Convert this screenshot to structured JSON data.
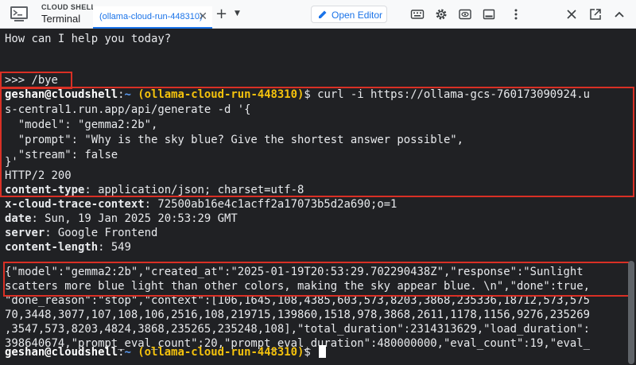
{
  "header": {
    "brand": "CLOUD SHELL",
    "title": "Terminal",
    "tab_label": "(ollama-cloud-run-448310)",
    "tab_close": "✕",
    "add_tab": "+",
    "tab_menu": "▼",
    "open_editor": "Open Editor"
  },
  "colors": {
    "accent": "#1a73e8",
    "highlight_box": "#d93025",
    "project_text": "#f4c20d",
    "path_text": "#5b9cf5",
    "terminal_bg": "#202124"
  },
  "terminal": {
    "greeting": "How can I help you today?",
    "bye": ">>> /bye",
    "prompt": {
      "user": "geshan@cloudshell",
      "sep": ":",
      "path": "~",
      "project": "(ollama-cloud-run-448310)",
      "dollar": "$ "
    },
    "curl_lines": [
      "curl -i https://ollama-gcs-760173090924.u",
      "s-central1.run.app/api/generate -d '{",
      "  \"model\": \"gemma2:2b\",",
      "  \"prompt\": \"Why is the sky blue? Give the shortest answer possible\",",
      "  \"stream\": false",
      "}'"
    ],
    "status_line": "HTTP/2 200",
    "headers": [
      {
        "key": "content-type",
        "value": ": application/json; charset=utf-8"
      },
      {
        "key": "x-cloud-trace-context",
        "value": ": 72500ab16e4c1acff2a17073b5d2a690;o=1"
      },
      {
        "key": "date",
        "value": ": Sun, 19 Jan 2025 20:53:29 GMT"
      },
      {
        "key": "server",
        "value": ": Google Frontend"
      },
      {
        "key": "content-length",
        "value": ": 549"
      }
    ],
    "body_lines": [
      "{\"model\":\"gemma2:2b\",\"created_at\":\"2025-01-19T20:53:29.702290438Z\",\"response\":\"Sunlight",
      "scatters more blue light than other colors, making the sky appear blue. \\n\",\"done\":true,",
      "\"done_reason\":\"stop\",\"context\":[106,1645,108,4385,603,573,8203,3868,235336,18712,573,575",
      "70,3448,3077,107,108,106,2516,108,219715,139860,1518,978,3868,2611,1178,1156,9276,235269",
      ",3547,573,8203,4824,3868,235265,235248,108],\"total_duration\":2314313629,\"load_duration\":",
      "398640674,\"prompt_eval_count\":20,\"prompt_eval_duration\":480000000,\"eval_count\":19,\"eval_"
    ]
  }
}
